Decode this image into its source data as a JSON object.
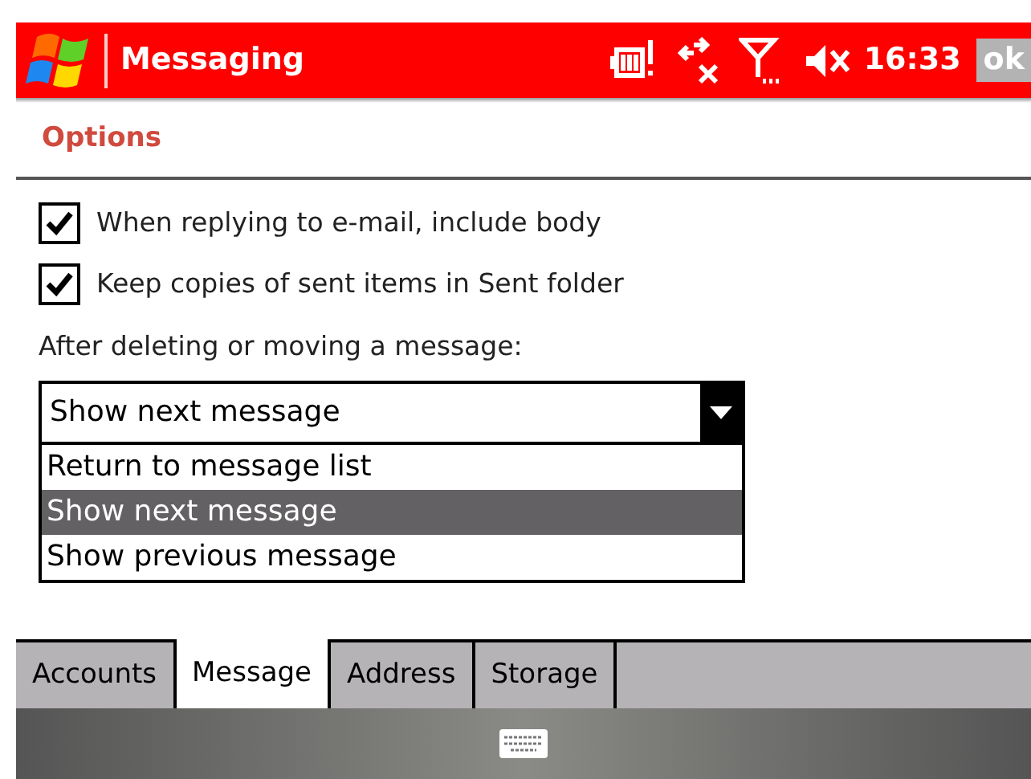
{
  "title_bar": {
    "title": "Messaging",
    "time": "16:33",
    "ok_button": "ok"
  },
  "page_heading": "Options",
  "checkboxes": [
    {
      "label": "When replying to e-mail, include body",
      "checked": true
    },
    {
      "label": "Keep copies of sent items in Sent folder",
      "checked": true
    }
  ],
  "dropdown": {
    "label": "After deleting or moving a message:",
    "value": "Show next message",
    "expanded": true,
    "options": [
      {
        "label": "Return to message list",
        "selected": false
      },
      {
        "label": "Show next message",
        "selected": true
      },
      {
        "label": "Show previous message",
        "selected": false
      }
    ]
  },
  "tabs": [
    {
      "label": "Accounts",
      "selected": false
    },
    {
      "label": "Message",
      "selected": true
    },
    {
      "label": "Address",
      "selected": false
    },
    {
      "label": "Storage",
      "selected": false
    }
  ]
}
